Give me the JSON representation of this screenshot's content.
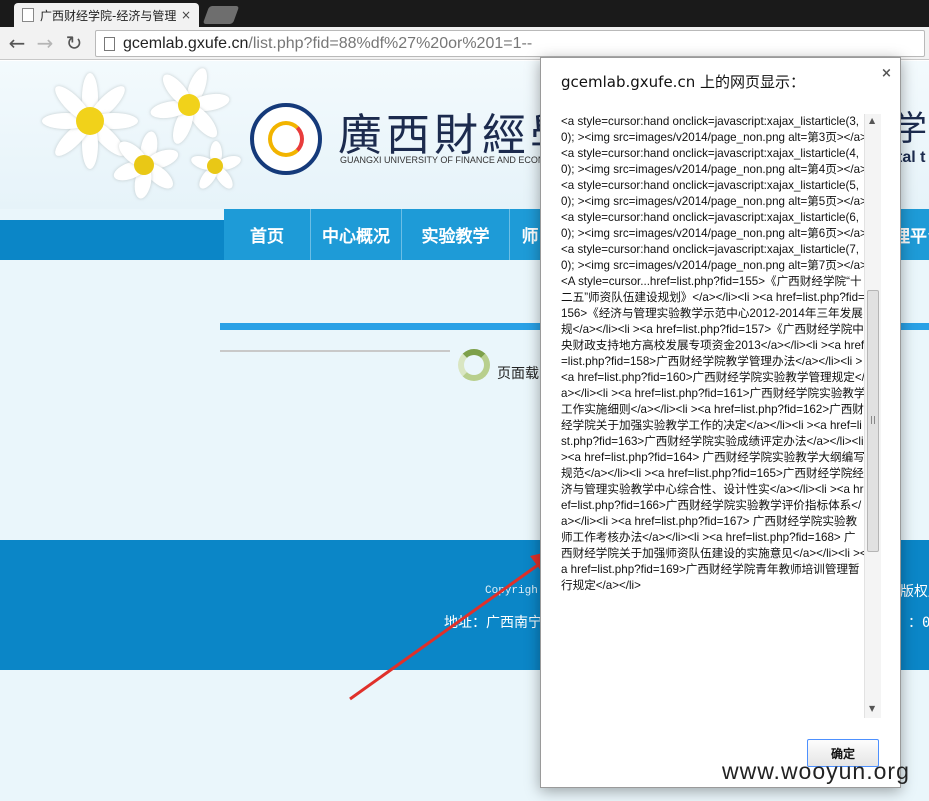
{
  "browser": {
    "tab_title": "广西财经学院-经济与管理",
    "tab_close": "×",
    "back_icon": "←",
    "forward_icon": "→",
    "reload_icon": "↻",
    "url_host": "gcemlab.gxufe.cn",
    "url_path": "/list.php?fid=88%df%27%20or%201=1--"
  },
  "site": {
    "school_name": "廣西財經學院",
    "school_name_en": "GUANGXI UNIVERSITY OF FINANCE AND ECONOMICS",
    "header_right_title": "学",
    "header_right_en": "tal t",
    "nav": [
      "首页",
      "中心概况",
      "实验教学",
      "师"
    ],
    "nav_right": "理平台",
    "loading_text": "页面载",
    "footer_copyright": "Copyrigh",
    "footer_copyright_right": "版权所",
    "footer_address": "地址：广西南宁",
    "footer_address_right": "：07"
  },
  "dialog": {
    "title": "gcemlab.gxufe.cn 上的网页显示：",
    "close": "×",
    "message": "<a style=cursor:hand onclick=javascript:xajax_listarticle(3,0); ><img src=images/v2014/page_non.png alt=第3页></a><a style=cursor:hand onclick=javascript:xajax_listarticle(4,0); ><img src=images/v2014/page_non.png alt=第4页></a><a style=cursor:hand onclick=javascript:xajax_listarticle(5,0); ><img src=images/v2014/page_non.png alt=第5页></a><a style=cursor:hand onclick=javascript:xajax_listarticle(6,0); ><img src=images/v2014/page_non.png alt=第6页></a><a style=cursor:hand onclick=javascript:xajax_listarticle(7,0); ><img src=images/v2014/page_non.png alt=第7页></a><A style=cursor...href=list.php?fid=155>《广西财经学院“十二五”师资队伍建设规划》</a></li><li ><a href=list.php?fid=156>《经济与管理实验教学示范中心2012-2014年三年发展规</a></li><li ><a href=list.php?fid=157>《广西财经学院中央财政支持地方高校发展专项资金2013</a></li><li ><a href=list.php?fid=158>广西财经学院教学管理办法</a></li><li ><a href=list.php?fid=160>广西财经学院实验教学管理规定</a></li><li ><a href=list.php?fid=161>广西财经学院实验教学工作实施细则</a></li><li ><a href=list.php?fid=162>广西财经学院关于加强实验教学工作的决定</a></li><li ><a href=list.php?fid=163>广西财经学院实验成绩评定办法</a></li><li ><a href=list.php?fid=164> 广西财经学院实验教学大纲编写规范</a></li><li ><a href=list.php?fid=165>广西财经学院经济与管理实验教学中心综合性、设计性实</a></li><li ><a href=list.php?fid=166>广西财经学院实验教学评价指标体系</a></li><li ><a href=list.php?fid=167> 广西财经学院实验教师工作考核办法</a></li><li ><a href=list.php?fid=168> 广西财经学院关于加强师资队伍建设的实施意见</a></li><li ><a href=list.php?fid=169>广西财经学院青年教师培训管理暂行规定</a></li>",
    "ok_label": "确定"
  },
  "watermark": "www.wooyun.org",
  "colors": {
    "nav_blue": "#1e9bd7",
    "footer_blue": "#0b86c7",
    "arrow_red": "#e0302a",
    "dialog_button_border": "#4d90fe"
  }
}
